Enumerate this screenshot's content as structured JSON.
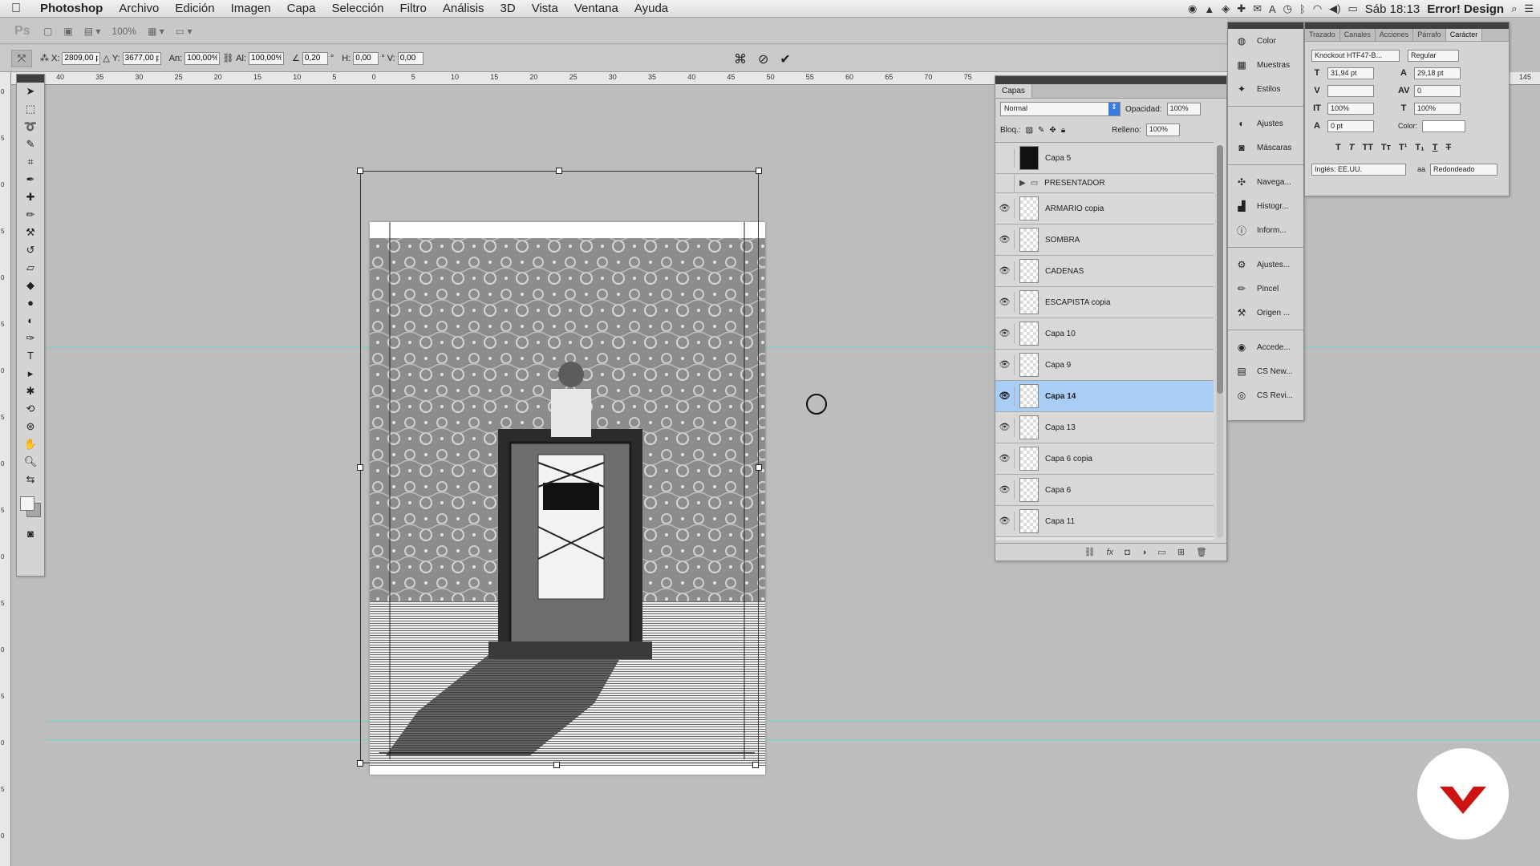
{
  "menubar": {
    "app": "Photoshop",
    "items": [
      "Archivo",
      "Edición",
      "Imagen",
      "Capa",
      "Selección",
      "Filtro",
      "Análisis",
      "3D",
      "Vista",
      "Ventana",
      "Ayuda"
    ],
    "time": "Sáb 18:13",
    "user": "Error! Design"
  },
  "appbar": {
    "logo": "Ps",
    "zoom": "100%"
  },
  "options": {
    "x_label": "X:",
    "x": "2809,00 p",
    "y_label": "Y:",
    "y": "3677,00 p",
    "w_label": "An:",
    "w": "100,00%",
    "h_label": "Al:",
    "h": "100,00%",
    "angle": "0,20",
    "hskew_label": "H:",
    "hskew": "0,00",
    "vskew_label": "V:",
    "vskew": "0,00"
  },
  "ruler_top": [
    "40",
    "35",
    "30",
    "25",
    "20",
    "15",
    "10",
    "5",
    "0",
    "5",
    "10",
    "15",
    "20",
    "25",
    "30",
    "35",
    "40",
    "45",
    "50",
    "55",
    "60",
    "65",
    "70",
    "75",
    "145"
  ],
  "ruler_left": [
    "0",
    "5",
    "0",
    "5",
    "0",
    "5",
    "0",
    "5",
    "0",
    "5",
    "0",
    "5",
    "0",
    "5",
    "0",
    "5",
    "0"
  ],
  "layers_panel": {
    "tab": "Capas",
    "blend_mode": "Normal",
    "opacity_label": "Opacidad:",
    "opacity": "100%",
    "lock_label": "Bloq.:",
    "fill_label": "Relleno:",
    "fill": "100%",
    "layers": [
      {
        "name": "Capa 5",
        "visible": false,
        "type": "layer",
        "thumb": "black"
      },
      {
        "name": "PRESENTADOR",
        "visible": false,
        "type": "group"
      },
      {
        "name": "ARMARIO copia",
        "visible": true,
        "type": "layer"
      },
      {
        "name": "SOMBRA",
        "visible": true,
        "type": "layer"
      },
      {
        "name": "CADENAS",
        "visible": true,
        "type": "layer"
      },
      {
        "name": "ESCAPISTA copia",
        "visible": true,
        "type": "layer"
      },
      {
        "name": "Capa 10",
        "visible": true,
        "type": "layer"
      },
      {
        "name": "Capa 9",
        "visible": true,
        "type": "layer"
      },
      {
        "name": "Capa 14",
        "visible": true,
        "type": "layer",
        "selected": true
      },
      {
        "name": "Capa 13",
        "visible": true,
        "type": "layer"
      },
      {
        "name": "Capa 6 copia",
        "visible": true,
        "type": "layer"
      },
      {
        "name": "Capa 6",
        "visible": true,
        "type": "layer"
      },
      {
        "name": "Capa 11",
        "visible": true,
        "type": "layer"
      }
    ]
  },
  "dock": {
    "items": [
      {
        "label": "Color",
        "icon": "color-wheel-icon"
      },
      {
        "label": "Muestras",
        "icon": "swatches-icon"
      },
      {
        "label": "Estilos",
        "icon": "styles-icon"
      },
      {
        "label": "Ajustes",
        "icon": "adjustments-icon"
      },
      {
        "label": "Máscaras",
        "icon": "masks-icon"
      },
      {
        "label": "Navega...",
        "icon": "navigator-icon"
      },
      {
        "label": "Histogr...",
        "icon": "histogram-icon"
      },
      {
        "label": "Inform...",
        "icon": "info-icon"
      },
      {
        "label": "Ajustes...",
        "icon": "tool-presets-icon"
      },
      {
        "label": "Pincel",
        "icon": "brush-icon"
      },
      {
        "label": "Origen ...",
        "icon": "clone-source-icon"
      },
      {
        "label": "Accede...",
        "icon": "access-icon"
      },
      {
        "label": "CS New...",
        "icon": "cs-news-icon"
      },
      {
        "label": "CS Revi...",
        "icon": "cs-review-icon"
      }
    ]
  },
  "character_panel": {
    "tabs": [
      "Trazado",
      "Canales",
      "Acciones",
      "Párrafo",
      "Carácter"
    ],
    "font": "Knockout HTF47-B...",
    "style": "Regular",
    "size": "31,94 pt",
    "leading": "29,18 pt",
    "kerning": "",
    "tracking": "0",
    "vscale": "100%",
    "hscale": "100%",
    "baseline": "0 pt",
    "color_label": "Color:",
    "language": "Inglés: EE.UU.",
    "aa_label": "aa",
    "antialias": "Redondeado"
  },
  "colors": {
    "selected_layer": "#a8cdf7",
    "guide": "#6fd3c8",
    "logo_red": "#cc1414"
  }
}
